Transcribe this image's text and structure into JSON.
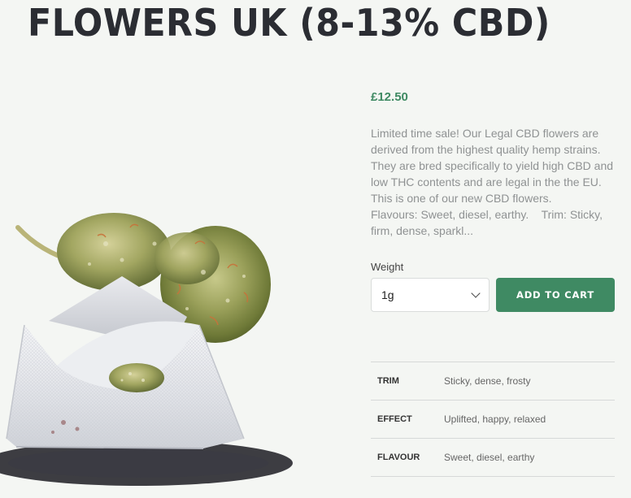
{
  "product": {
    "title": "FLOWERS UK (8-13% CBD)",
    "price": "£12.50",
    "description_lines": [
      "Limited time sale! Our Legal CBD flowers are",
      "derived from the highest quality hemp strains.",
      "They are bred specifically to yield high CBD and",
      "low THC contents and are legal in the the EU.",
      "This is one of our new CBD flowers.",
      "Flavours: Sweet, diesel, earthy.    Trim: Sticky,",
      "firm, dense, sparkl..."
    ],
    "image_alt": "CBD flower buds with small paper bag"
  },
  "variation": {
    "label": "Weight",
    "selected": "1g"
  },
  "cart": {
    "button_label": "ADD TO CART"
  },
  "attributes": [
    {
      "key": "TRIM",
      "value": "Sticky, dense, frosty"
    },
    {
      "key": "EFFECT",
      "value": "Uplifted, happy, relaxed"
    },
    {
      "key": "FLAVOUR",
      "value": "Sweet, diesel, earthy"
    }
  ],
  "colors": {
    "accent": "#3f8a63",
    "background": "#f4f6f3",
    "title": "#2b2d33"
  }
}
